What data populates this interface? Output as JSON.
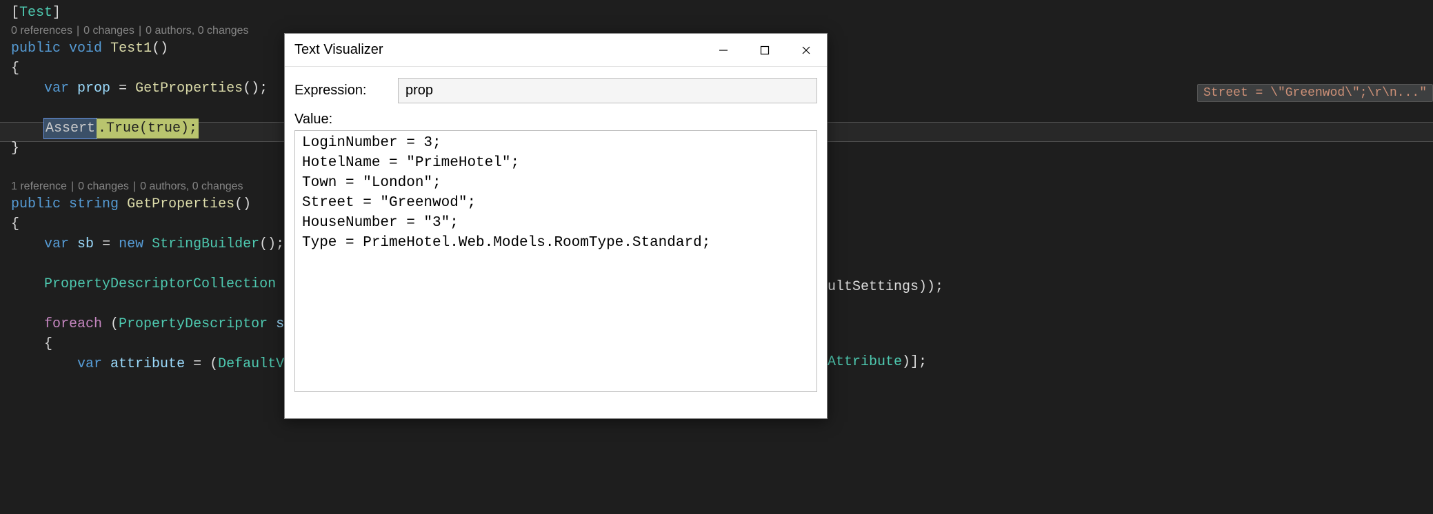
{
  "code": {
    "attribute_open": "[",
    "attribute_name": "Test",
    "attribute_close": "]",
    "codelens1": {
      "refs": "0 references",
      "changes": "0 changes",
      "authors": "0 authors, 0 changes"
    },
    "method1_decl": {
      "kw_public": "public",
      "kw_void": "void",
      "name": "Test1",
      "parens": "()"
    },
    "brace_open": "{",
    "var_prop": {
      "kw_var": "var",
      "name": "prop",
      "eq": " = ",
      "call": "GetProperties",
      "parens": "();"
    },
    "assert": {
      "cls": "Assert",
      "rest": ".True(true);"
    },
    "brace_close": "}",
    "codelens2": {
      "refs": "1 reference",
      "changes": "0 changes",
      "authors": "0 authors, 0 changes"
    },
    "method2_decl": {
      "kw_public": "public",
      "kw_string": "string",
      "name": "GetProperties",
      "parens": "()"
    },
    "var_sb": {
      "kw_var": "var",
      "name": "sb",
      "eq": " = ",
      "kw_new": "new",
      "type": "StringBuilder",
      "parens": "();"
    },
    "pdc": "PropertyDescriptorCollection",
    "foreach": {
      "kw": "foreach",
      "open": " (",
      "type": "PropertyDescriptor",
      "s": " s"
    },
    "inner_brace": "{",
    "var_attr": {
      "kw_var": "var",
      "name": "attribute",
      "eq": " = (",
      "type": "DefaultV"
    }
  },
  "right": {
    "l1": "ultSettings));",
    "l2": "Attribute)];"
  },
  "datatip": "Street = \\\"Greenwod\\\";\\r\\n...\"",
  "dialog": {
    "title": "Text Visualizer",
    "expr_label": "Expression:",
    "expr_value": "prop",
    "value_label": "Value:",
    "value_text": "LoginNumber = 3;\nHotelName = \"PrimeHotel\";\nTown = \"London\";\nStreet = \"Greenwod\";\nHouseNumber = \"3\";\nType = PrimeHotel.Web.Models.RoomType.Standard;\n"
  }
}
